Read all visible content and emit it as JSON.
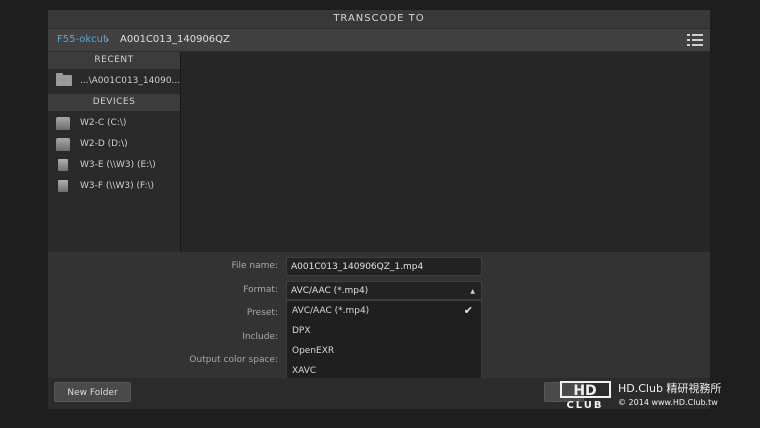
{
  "dialog": {
    "title": "TRANSCODE TO"
  },
  "path": {
    "root": "F55-okcut",
    "separator": "›",
    "current": "A001C013_140906QZ"
  },
  "sidebar": {
    "recent_label": "RECENT",
    "recent": [
      {
        "label": "...\\A001C013_14090...",
        "icon": "folder-icon"
      }
    ],
    "devices_label": "DEVICES",
    "devices": [
      {
        "label": "W2-C (C:\\)",
        "icon": "drive-icon"
      },
      {
        "label": "W2-D (D:\\)",
        "icon": "drive-icon"
      },
      {
        "label": "W3-E (\\\\W3) (E:\\)",
        "icon": "network-drive-icon"
      },
      {
        "label": "W3-F (\\\\W3) (F:\\)",
        "icon": "network-drive-icon"
      }
    ]
  },
  "form": {
    "file_name_label": "File name:",
    "file_name_value": "A001C013_140906QZ_1.mp4",
    "format_label": "Format:",
    "format_value": "AVC/AAC (*.mp4)",
    "preset_label": "Preset:",
    "include_label": "Include:",
    "output_color_space_label": "Output color space:",
    "format_options": [
      "AVC/AAC (*.mp4)",
      "DPX",
      "OpenEXR",
      "XAVC"
    ],
    "selected_option": "AVC/AAC (*.mp4)"
  },
  "footer": {
    "new_folder_label": "New Folder"
  },
  "watermark": {
    "logo_top": "HD",
    "logo_bottom": "CLUB",
    "name": "HD.Club 精研視務所",
    "copyright": "© 2014  www.HD.Club.tw"
  }
}
